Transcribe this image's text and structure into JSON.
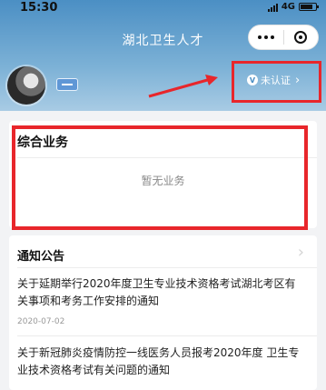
{
  "status_bar": {
    "time": "15:30",
    "network": "4G"
  },
  "header": {
    "title": "湖北卫生人才"
  },
  "profile": {
    "verify_label": "未认证",
    "verify_icon_letter": "V"
  },
  "business": {
    "title": "综合业务",
    "empty_text": "暂无业务"
  },
  "notices": {
    "heading": "通知公告",
    "items": [
      {
        "title": "关于延期举行2020年度卫生专业技术资格考试湖北考区有关事项和考务工作安排的通知",
        "date": "2020-07-02"
      },
      {
        "title": "关于新冠肺炎疫情防控一线医务人员报考2020年度 卫生专业技术资格考试有关问题的通知"
      }
    ]
  },
  "colors": {
    "header_top": "#4b8fc4",
    "highlight": "#e8262b"
  }
}
